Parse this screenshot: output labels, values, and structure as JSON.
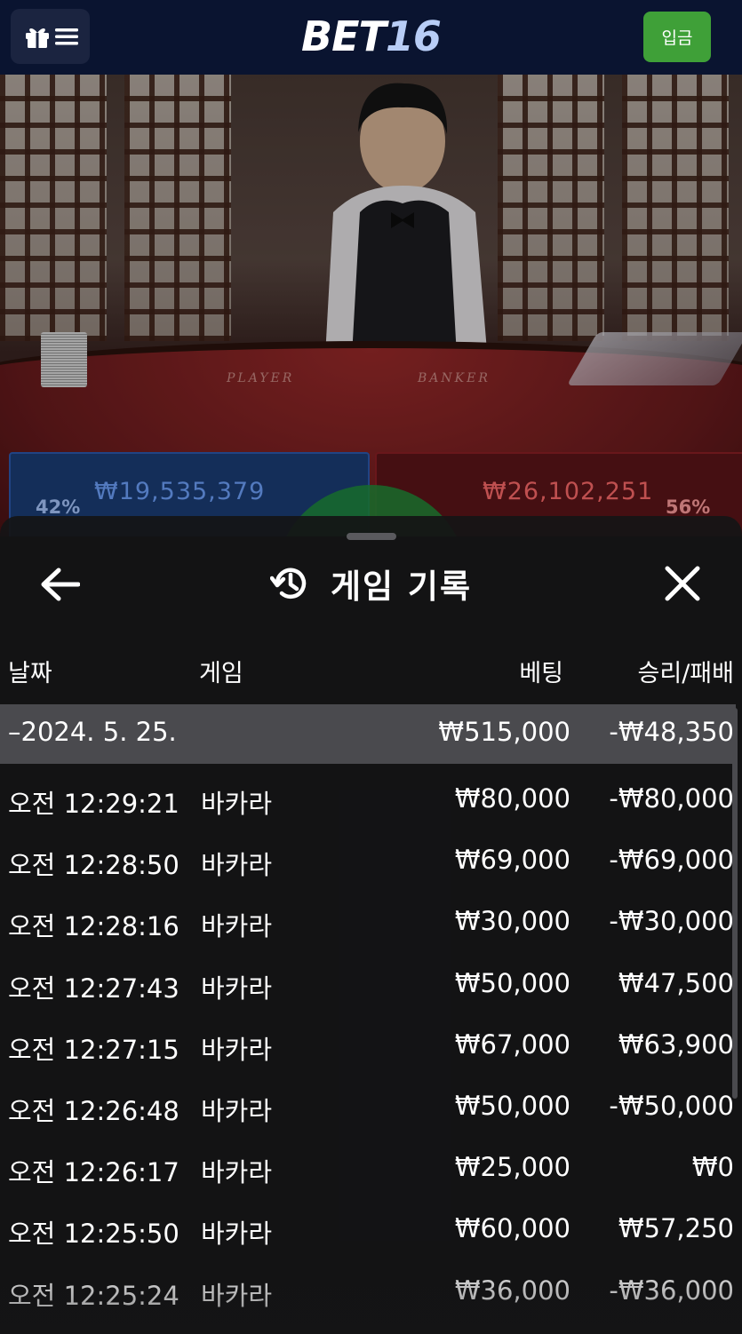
{
  "header": {
    "logo_text": "BET",
    "logo_num": "16",
    "deposit_label": "입금"
  },
  "table": {
    "felt_player": "PLAYER",
    "felt_banker": "BANKER",
    "player_pct": "42%",
    "player_amount": "₩19,535,379",
    "banker_pct": "56%",
    "banker_amount": "₩26,102,251"
  },
  "sheet": {
    "title": "게임 기록",
    "columns": {
      "date": "날짜",
      "game": "게임",
      "bet": "베팅",
      "winloss": "승리/패배"
    },
    "date_group": {
      "date": "–2024. 5. 25.",
      "bet": "₩515,000",
      "winloss": "-₩48,350"
    },
    "rows": [
      {
        "time": "오전 12:29:21",
        "game": "바카라",
        "bet": "₩80,000",
        "winloss": "-₩80,000"
      },
      {
        "time": "오전 12:28:50",
        "game": "바카라",
        "bet": "₩69,000",
        "winloss": "-₩69,000"
      },
      {
        "time": "오전 12:28:16",
        "game": "바카라",
        "bet": "₩30,000",
        "winloss": "-₩30,000"
      },
      {
        "time": "오전 12:27:43",
        "game": "바카라",
        "bet": "₩50,000",
        "winloss": "₩47,500"
      },
      {
        "time": "오전 12:27:15",
        "game": "바카라",
        "bet": "₩67,000",
        "winloss": "₩63,900"
      },
      {
        "time": "오전 12:26:48",
        "game": "바카라",
        "bet": "₩50,000",
        "winloss": "-₩50,000"
      },
      {
        "time": "오전 12:26:17",
        "game": "바카라",
        "bet": "₩25,000",
        "winloss": "₩0"
      },
      {
        "time": "오전 12:25:50",
        "game": "바카라",
        "bet": "₩60,000",
        "winloss": "₩57,250"
      },
      {
        "time": "오전 12:25:24",
        "game": "바카라",
        "bet": "₩36,000",
        "winloss": "-₩36,000"
      }
    ]
  }
}
